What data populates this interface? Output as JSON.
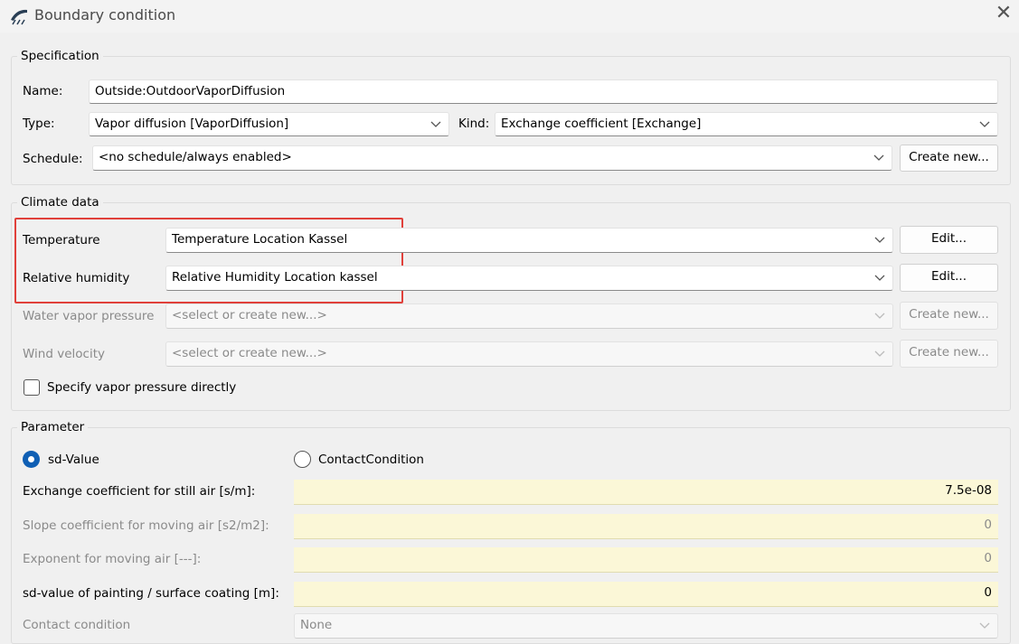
{
  "window": {
    "title": "Boundary condition"
  },
  "specification": {
    "group_title": "Specification",
    "name_label": "Name:",
    "name_value": "Outside:OutdoorVaporDiffusion",
    "type_label": "Type:",
    "type_value": "Vapor diffusion [VaporDiffusion]",
    "kind_label": "Kind:",
    "kind_value": "Exchange coefficient [Exchange]",
    "schedule_label": "Schedule:",
    "schedule_value": "<no schedule/always enabled>",
    "create_new_label": "Create new..."
  },
  "climate": {
    "group_title": "Climate data",
    "temperature_label": "Temperature",
    "temperature_value": "Temperature Location Kassel",
    "humidity_label": "Relative humidity",
    "humidity_value": "Relative Humidity Location kassel",
    "edit_label": "Edit...",
    "vapor_pressure_label": "Water vapor pressure",
    "vapor_pressure_placeholder": "<select or create new...>",
    "wind_label": "Wind velocity",
    "wind_placeholder": "<select or create new...>",
    "create_new_label": "Create new...",
    "checkbox_label": "Specify vapor pressure directly",
    "checkbox_checked": false
  },
  "parameter": {
    "group_title": "Parameter",
    "radio_sd_label": "sd-Value",
    "radio_contact_label": "ContactCondition",
    "selected": "sd-Value",
    "rows": [
      {
        "label": "Exchange coefficient for still air [s/m]:",
        "value": "7.5e-08",
        "enabled": true
      },
      {
        "label": "Slope coefficient for moving air [s2/m2]:",
        "value": "0",
        "enabled": false
      },
      {
        "label": "Exponent for moving air [---]:",
        "value": "0",
        "enabled": false
      },
      {
        "label": "sd-value of painting / surface coating [m]:",
        "value": "0",
        "enabled": true
      }
    ],
    "contact_label": "Contact condition",
    "contact_value": "None"
  },
  "colors": {
    "accent": "#0f5fb4",
    "highlight": "#e0403a",
    "param_field_bg": "#fbf7d7"
  }
}
